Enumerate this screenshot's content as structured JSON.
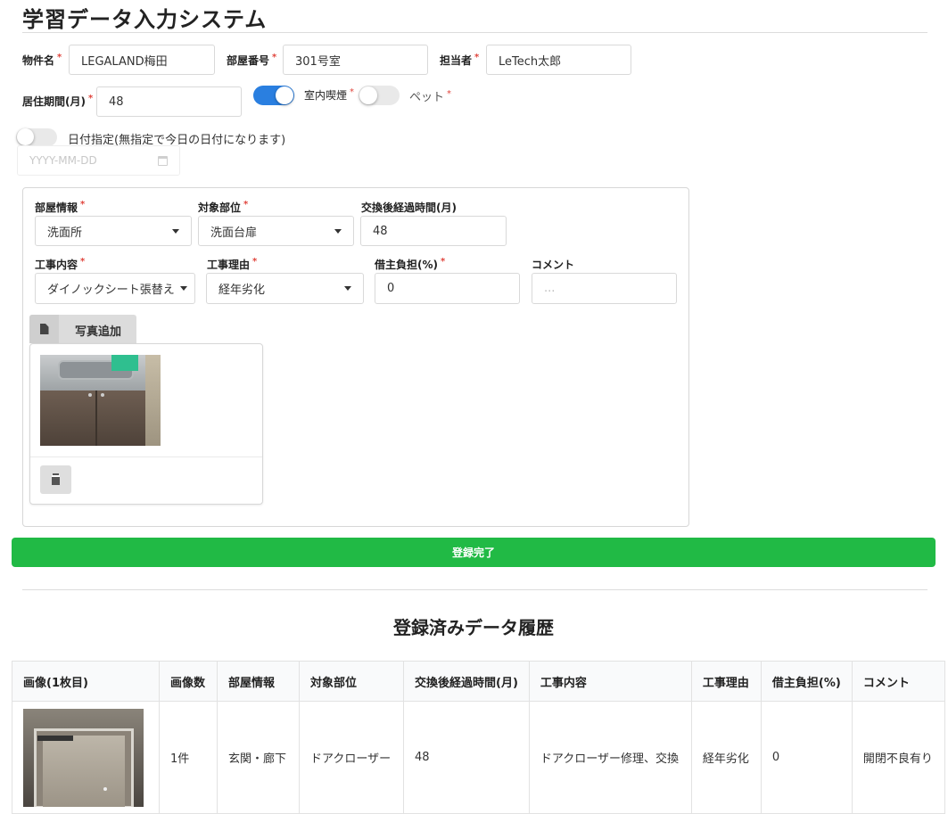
{
  "app": {
    "title": "学習データ入力システム"
  },
  "form": {
    "property_label": "物件名",
    "property_value": "LEGALAND梅田",
    "room_no_label": "部屋番号",
    "room_no_value": "301号室",
    "staff_label": "担当者",
    "staff_value": "LeTech太郎",
    "residence_label": "居住期間(月)",
    "residence_value": "48",
    "smoking_label": "室内喫煙",
    "smoking_on": true,
    "pet_label": "ペット",
    "pet_on": false,
    "date_toggle_label": "日付指定(無指定で今日の日付になります)",
    "date_toggle_on": false,
    "date_placeholder": "YYYY-MM-DD",
    "required_mark": "*"
  },
  "entry": {
    "room_info_label": "部屋情報",
    "room_info_value": "洗面所",
    "target_part_label": "対象部位",
    "target_part_value": "洗面台扉",
    "elapsed_label": "交換後経過時間(月)",
    "elapsed_value": "48",
    "work_label": "工事内容",
    "work_value": "ダイノックシート張替え",
    "reason_label": "工事理由",
    "reason_value": "経年劣化",
    "owner_label": "借主負担(%)",
    "owner_value": "0",
    "comment_label": "コメント",
    "comment_placeholder": "...",
    "add_photo_label": "写真追加"
  },
  "submit_label": "登録完了",
  "history": {
    "title": "登録済みデータ履歴",
    "columns": [
      "画像(1枚目)",
      "画像数",
      "部屋情報",
      "対象部位",
      "交換後経過時間(月)",
      "工事内容",
      "工事理由",
      "借主負担(%)",
      "コメント"
    ],
    "rows": [
      {
        "count": "1件",
        "room": "玄関・廊下",
        "part": "ドアクローザー",
        "elapsed": "48",
        "work": "ドアクローザー修理、交換",
        "reason": "経年劣化",
        "owner": "0",
        "comment": "開閉不良有り"
      }
    ]
  },
  "colors": {
    "accent": "#2a7fe0",
    "submit": "#21ba45",
    "required": "#e0443c"
  }
}
